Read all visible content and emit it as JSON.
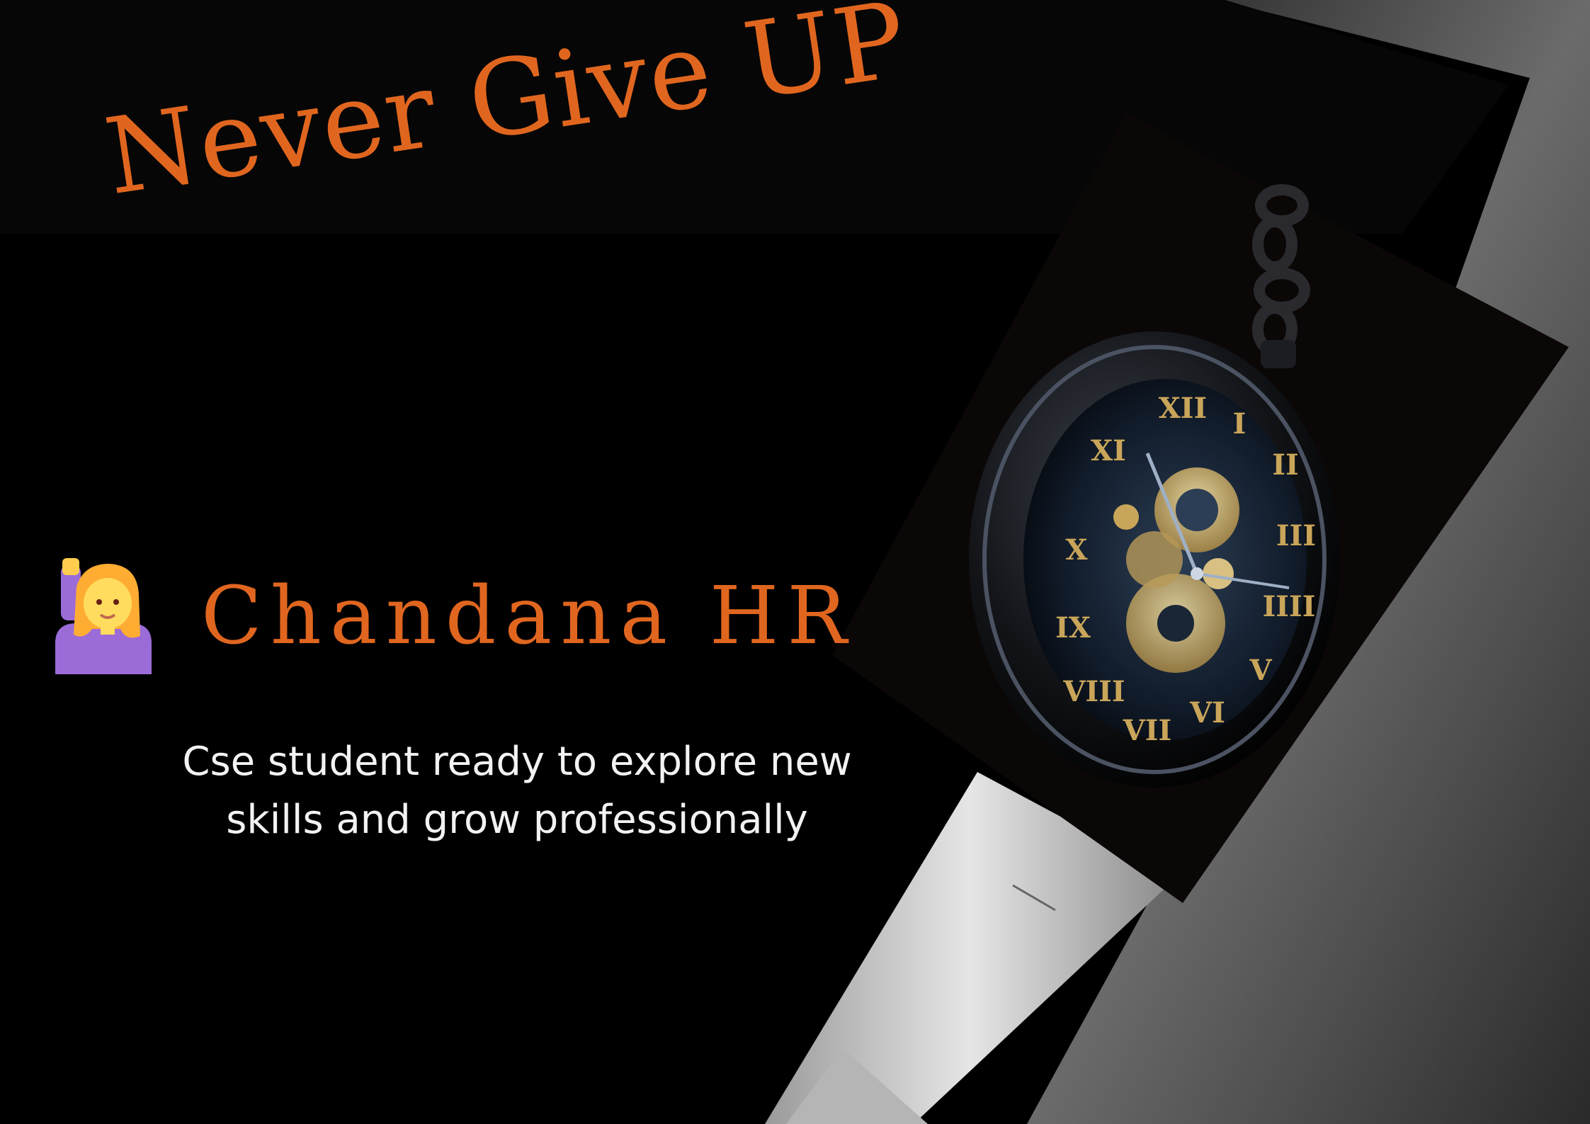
{
  "poster": {
    "headline": "Never Give UP",
    "name": "Chandana HR",
    "tagline": [
      "Cse student ready to explore new",
      "skills and grow professionally"
    ]
  },
  "icons": {
    "avatar": "person-raising-hand-icon",
    "watch": "pocket-watch-icon"
  },
  "colors": {
    "background": "#000000",
    "accent": "#e0661f",
    "tagline": "#f2f2f2",
    "watch_numerals": "#c9a55a"
  }
}
